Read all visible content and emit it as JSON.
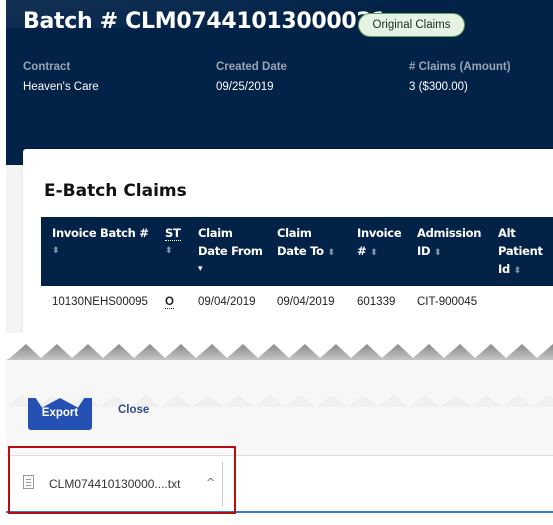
{
  "batch": {
    "title": "Batch # CLM07441013000021",
    "badge": "Original Claims"
  },
  "meta": [
    {
      "label": "Contract",
      "value": "Heaven's Care"
    },
    {
      "label": "Created Date",
      "value": "09/25/2019"
    },
    {
      "label": "# Claims (Amount)",
      "value": "3 ($300.00)"
    }
  ],
  "table": {
    "title": "E-Batch Claims",
    "columns": [
      {
        "lines": [
          "Invoice Batch #"
        ],
        "sort": "⬍"
      },
      {
        "lines": [
          "ST"
        ],
        "sort": "⬍"
      },
      {
        "lines": [
          "Claim",
          "Date From"
        ],
        "sort": "▾"
      },
      {
        "lines": [
          "Claim",
          "Date To"
        ],
        "sort": "⬍"
      },
      {
        "lines": [
          "Invoice",
          "#"
        ],
        "sort": "⬍"
      },
      {
        "lines": [
          "Admission",
          "ID"
        ],
        "sort": "⬍"
      },
      {
        "lines": [
          "Alt",
          "Patient",
          "Id"
        ],
        "sort": "⬍"
      }
    ],
    "rows": [
      [
        "10130NEHS00095",
        "O",
        "09/04/2019",
        "09/04/2019",
        "601339",
        "CIT-900045",
        ""
      ]
    ]
  },
  "actions": {
    "export": "Export",
    "close": "Close"
  },
  "download": {
    "file_name": "CLM074410130000....txt",
    "chevron": "^"
  },
  "colors": {
    "header_bg": "#022248",
    "badge_bg": "#e5f3e3",
    "export_btn": "#2450b4",
    "highlight_box": "#b50d12",
    "download_bar_accent": "#2b7fd0"
  }
}
